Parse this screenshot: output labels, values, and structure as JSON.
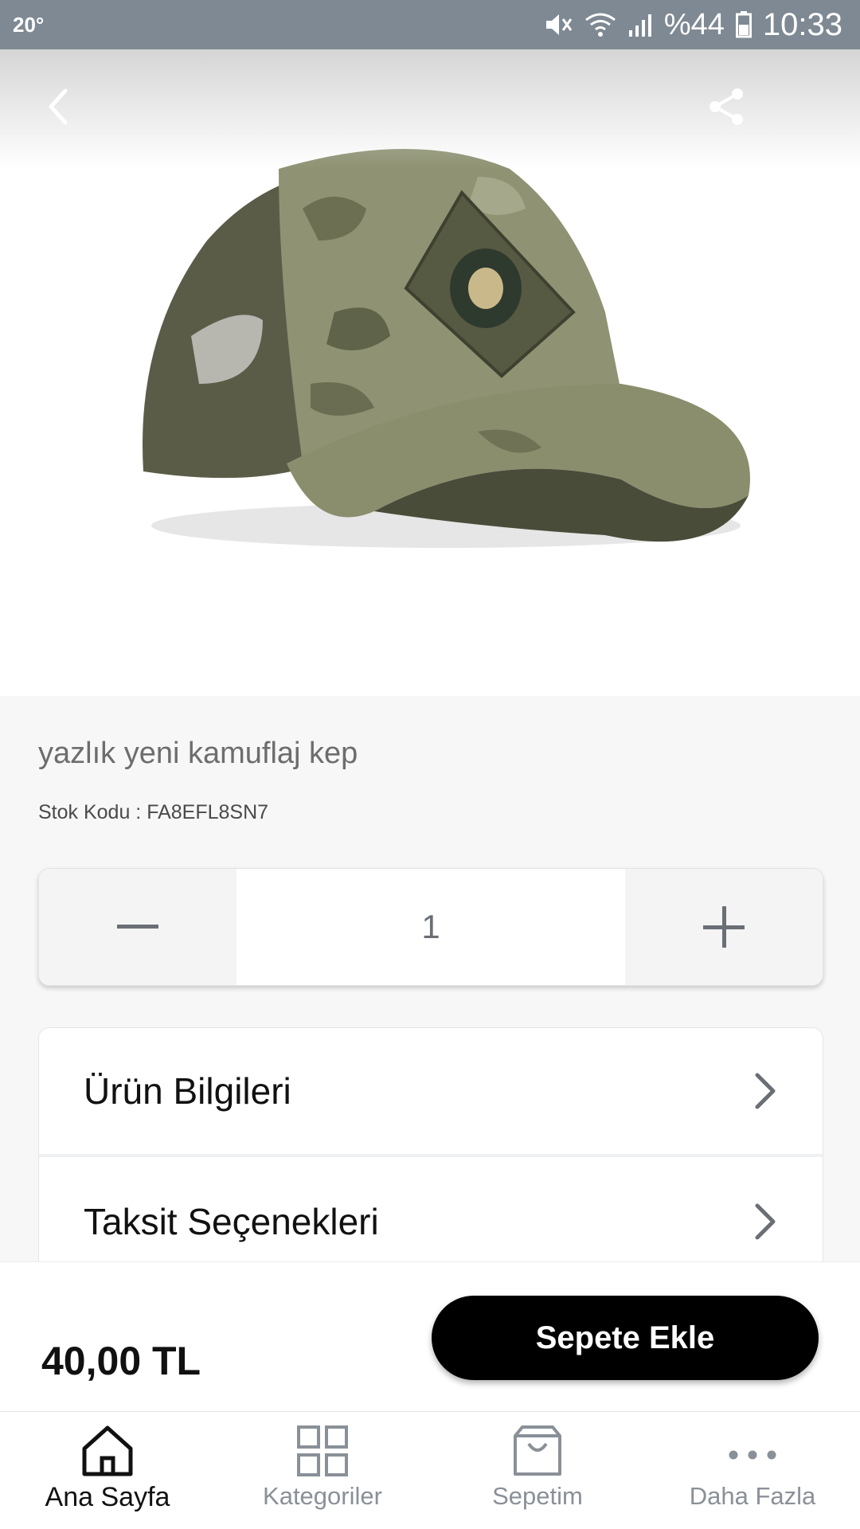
{
  "status_bar": {
    "temperature": "20°",
    "battery_percent": "%44",
    "time": "10:33"
  },
  "product": {
    "title": "yazlık yeni kamuflaj kep",
    "stock_code": "Stok Kodu : FA8EFL8SN7",
    "quantity": "1",
    "price": "40,00 TL"
  },
  "info_sections": [
    {
      "label": "Ürün Bilgileri",
      "icon": "chevron-right-icon"
    },
    {
      "label": "Taksit Seçenekleri",
      "icon": "chevron-right-icon"
    }
  ],
  "actions": {
    "add_to_cart": "Sepete Ekle"
  },
  "bottom_nav": [
    {
      "label": "Ana Sayfa",
      "icon": "home-icon",
      "active": true
    },
    {
      "label": "Kategoriler",
      "icon": "grid-icon",
      "active": false
    },
    {
      "label": "Sepetim",
      "icon": "bag-icon",
      "active": false
    },
    {
      "label": "Daha Fazla",
      "icon": "more-icon",
      "active": false
    }
  ],
  "colors": {
    "status_bar": "#7e8993",
    "button_bg": "#000000",
    "inactive_nav": "#8a9098"
  }
}
